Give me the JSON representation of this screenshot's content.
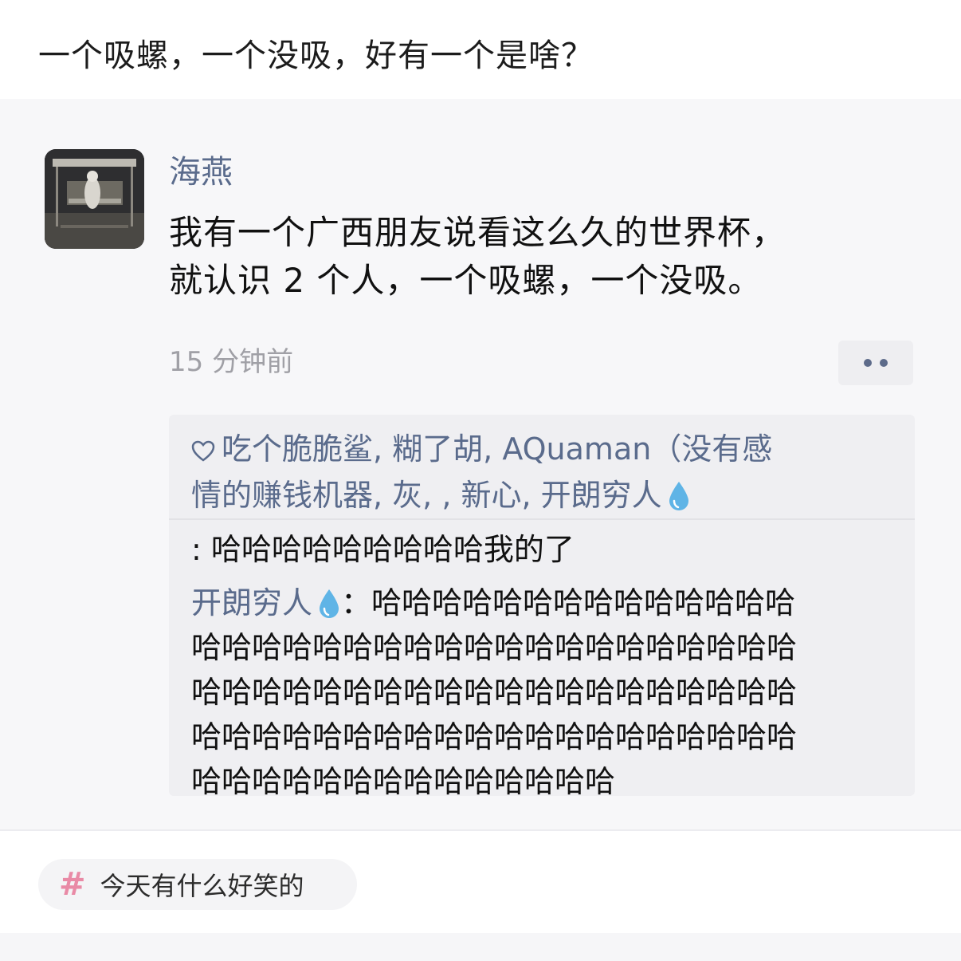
{
  "header": {
    "title": "一个吸螺，一个没吸，好有一个是啥？"
  },
  "post": {
    "username": "海燕",
    "text_lines": [
      "我有一个广西朋友说看这么久的世界杯，",
      "就认识 2 个人，一个吸螺，一个没吸。"
    ],
    "timestamp": "15 分钟前",
    "avatar_icon": "swing-photo-avatar"
  },
  "likes": {
    "line1": "吃个脆脆鲨, 糊了胡, AQuaman（没有感",
    "line2": "情的赚钱机器, 灰, , 新心, 开朗穷人",
    "icon": "heart-outline-icon",
    "emoji": "water-drop-icon"
  },
  "comments": [
    {
      "author": "",
      "text": ": 哈哈哈哈哈哈哈哈哈我的了"
    },
    {
      "author": "开朗穷人",
      "author_emoji": "water-drop-icon",
      "lines": [
        "：哈哈哈哈哈哈哈哈哈哈哈哈哈哈",
        "哈哈哈哈哈哈哈哈哈哈哈哈哈哈哈哈哈哈哈哈",
        "哈哈哈哈哈哈哈哈哈哈哈哈哈哈哈哈哈哈哈哈",
        "哈哈哈哈哈哈哈哈哈哈哈哈哈哈哈哈哈哈哈哈",
        "哈哈哈哈哈哈哈哈哈哈哈哈哈哈"
      ]
    }
  ],
  "topic": {
    "label": "今天有什么好笑的",
    "icon": "hashtag-icon",
    "color": "#e98aa6"
  },
  "colors": {
    "name_blue": "#5a6b8c",
    "card_bg": "#f7f7f9",
    "reply_bg": "#efeff2"
  }
}
